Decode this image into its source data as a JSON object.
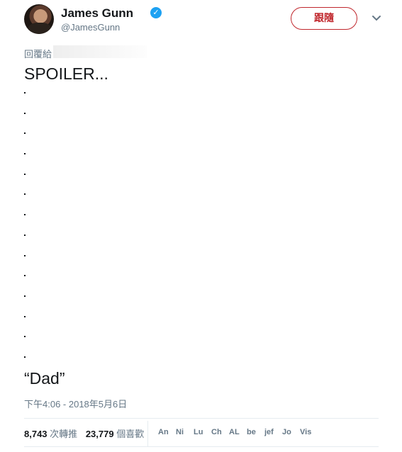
{
  "author": {
    "name": "James Gunn",
    "handle": "@JamesGunn",
    "verified_icon": "verified-badge-icon"
  },
  "follow_button": {
    "label": "跟隨",
    "color": "#c0272d"
  },
  "more_icon": "chevron-down-icon",
  "reply": {
    "prefix": "回覆給"
  },
  "tweet": {
    "line1": "SPOILER...",
    "dot": ".",
    "dot_count": 14,
    "line2": "“Dad”"
  },
  "timestamp": "下午4:06 - 2018年5月6日",
  "stats": {
    "retweets_count": "8,743",
    "retweets_label": "次轉推",
    "likes_count": "23,779",
    "likes_label": "個喜歡"
  },
  "likers": [
    "An",
    "Ni",
    "Lu",
    "Ch",
    "AL",
    "be",
    "jef",
    "Jo",
    "Vis"
  ],
  "colors": {
    "verified": "#1da1f2",
    "muted": "#657786",
    "text": "#14171a"
  }
}
